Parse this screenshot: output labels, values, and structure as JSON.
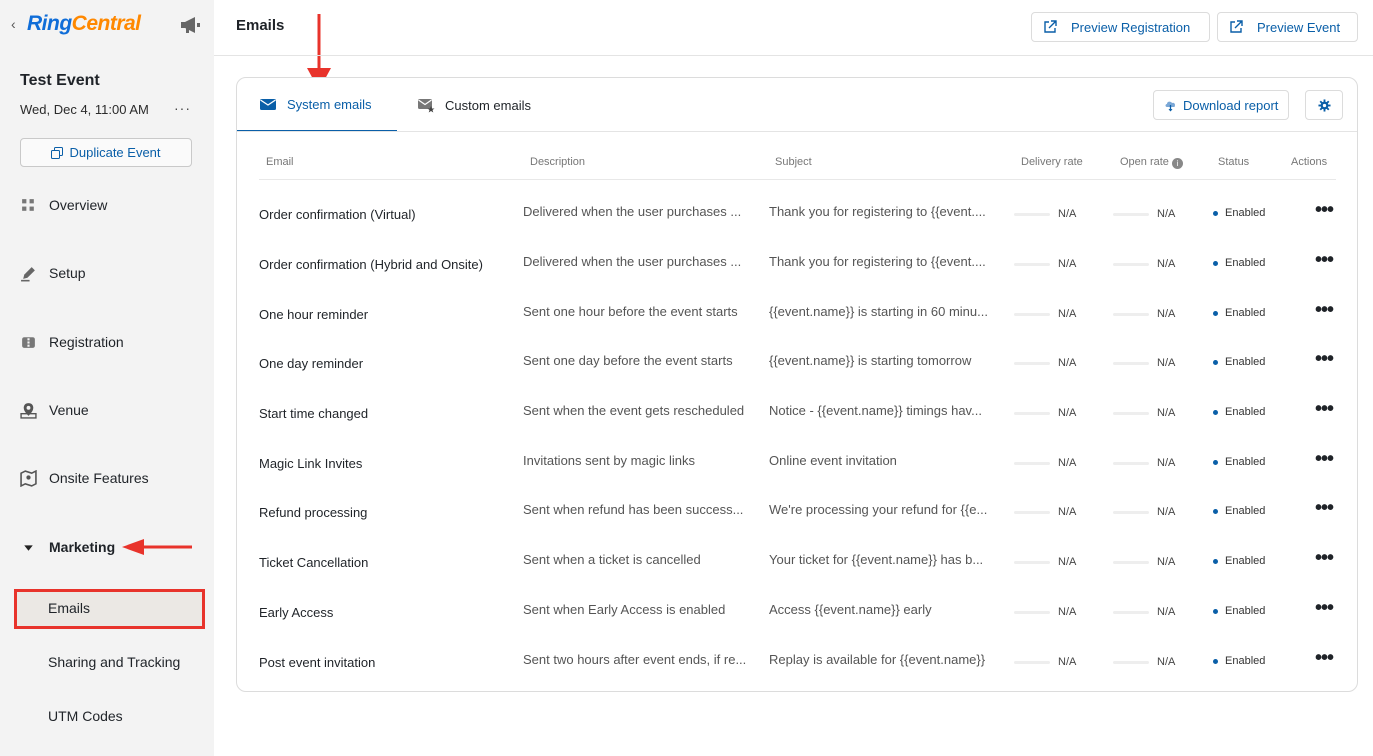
{
  "app": {
    "logo_ring": "Ring",
    "logo_central": "Central",
    "back_chevron": "‹"
  },
  "event": {
    "title": "Test Event",
    "date": "Wed, Dec 4, 11:00 AM",
    "more": "···",
    "duplicate_label": "Duplicate Event"
  },
  "sidebar": {
    "items": [
      {
        "label": "Overview",
        "icon": "grid-icon"
      },
      {
        "label": "Setup",
        "icon": "pencil-icon"
      },
      {
        "label": "Registration",
        "icon": "ticket-icon"
      },
      {
        "label": "Venue",
        "icon": "map-pin-icon"
      },
      {
        "label": "Onsite Features",
        "icon": "map-icon"
      },
      {
        "label": "Marketing",
        "icon": "caret-down-icon"
      }
    ],
    "sub_items": [
      {
        "label": "Emails"
      },
      {
        "label": "Sharing and Tracking"
      },
      {
        "label": "UTM Codes"
      }
    ]
  },
  "header": {
    "title": "Emails",
    "preview_registration": "Preview Registration",
    "preview_event": "Preview Event"
  },
  "tabs": {
    "system": "System emails",
    "custom": "Custom emails"
  },
  "toolbar": {
    "download_report": "Download report"
  },
  "table": {
    "headers": {
      "email": "Email",
      "description": "Description",
      "subject": "Subject",
      "delivery": "Delivery rate",
      "open": "Open rate",
      "status": "Status",
      "actions": "Actions"
    },
    "rows": [
      {
        "email": "Order confirmation (Virtual)",
        "description": "Delivered when the user purchases ...",
        "subject": "Thank you for registering to {{event....",
        "delivery": "N/A",
        "open": "N/A",
        "status": "Enabled"
      },
      {
        "email": "Order confirmation (Hybrid and Onsite)",
        "description": "Delivered when the user purchases ...",
        "subject": "Thank you for registering to {{event....",
        "delivery": "N/A",
        "open": "N/A",
        "status": "Enabled"
      },
      {
        "email": "One hour reminder",
        "description": "Sent one hour before the event starts",
        "subject": "{{event.name}} is starting in 60 minu...",
        "delivery": "N/A",
        "open": "N/A",
        "status": "Enabled"
      },
      {
        "email": "One day reminder",
        "description": "Sent one day before the event starts",
        "subject": "{{event.name}} is starting tomorrow",
        "delivery": "N/A",
        "open": "N/A",
        "status": "Enabled"
      },
      {
        "email": "Start time changed",
        "description": "Sent when the event gets rescheduled",
        "subject": "Notice - {{event.name}} timings hav...",
        "delivery": "N/A",
        "open": "N/A",
        "status": "Enabled"
      },
      {
        "email": "Magic Link Invites",
        "description": "Invitations sent by magic links",
        "subject": "Online event invitation",
        "delivery": "N/A",
        "open": "N/A",
        "status": "Enabled"
      },
      {
        "email": "Refund processing",
        "description": "Sent when refund has been success...",
        "subject": "We're processing your refund for {{e...",
        "delivery": "N/A",
        "open": "N/A",
        "status": "Enabled"
      },
      {
        "email": "Ticket Cancellation",
        "description": "Sent when a ticket is cancelled",
        "subject": "Your ticket for {{event.name}} has b...",
        "delivery": "N/A",
        "open": "N/A",
        "status": "Enabled"
      },
      {
        "email": "Early Access",
        "description": "Sent when Early Access is enabled",
        "subject": "Access {{event.name}} early",
        "delivery": "N/A",
        "open": "N/A",
        "status": "Enabled"
      },
      {
        "email": "Post event invitation",
        "description": "Sent two hours after event ends, if re...",
        "subject": "Replay is available for {{event.name}}",
        "delivery": "N/A",
        "open": "N/A",
        "status": "Enabled"
      }
    ],
    "actions_glyph": "•••"
  },
  "colors": {
    "accent": "#0a5fa8",
    "annotation_red": "#e8332b",
    "sidebar_bg": "#f3f3f3",
    "logo_blue": "#0f6dd8",
    "logo_orange": "#ff8800"
  }
}
